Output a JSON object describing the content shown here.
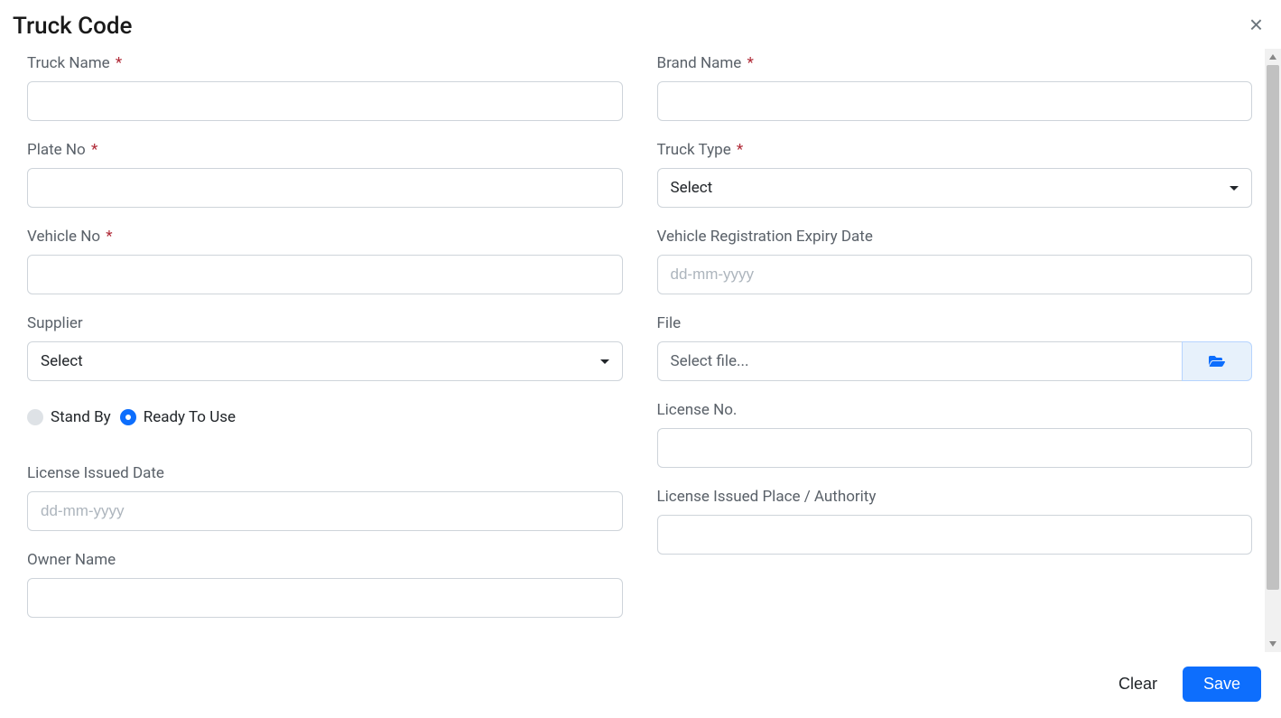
{
  "modal": {
    "title": "Truck Code",
    "close_symbol": "×"
  },
  "form": {
    "left": {
      "truck_name": {
        "label": "Truck Name",
        "required": true,
        "value": ""
      },
      "plate_no": {
        "label": "Plate No",
        "required": true,
        "value": ""
      },
      "vehicle_no": {
        "label": "Vehicle No",
        "required": true,
        "value": ""
      },
      "supplier": {
        "label": "Supplier",
        "selected": "Select"
      },
      "status_radios": {
        "standby": {
          "label": "Stand By",
          "checked": false
        },
        "ready": {
          "label": "Ready To Use",
          "checked": true
        }
      },
      "license_issued_date": {
        "label": "License Issued Date",
        "placeholder": "dd-mm-yyyy",
        "value": ""
      },
      "owner_name": {
        "label": "Owner Name",
        "value": ""
      }
    },
    "right": {
      "brand_name": {
        "label": "Brand Name",
        "required": true,
        "value": ""
      },
      "truck_type": {
        "label": "Truck Type",
        "required": true,
        "selected": "Select"
      },
      "reg_expiry": {
        "label": "Vehicle Registration Expiry Date",
        "placeholder": "dd-mm-yyyy",
        "value": ""
      },
      "file": {
        "label": "File",
        "placeholder": "Select file..."
      },
      "license_no": {
        "label": "License No.",
        "value": ""
      },
      "license_place": {
        "label": "License Issued Place / Authority",
        "value": ""
      }
    }
  },
  "footer": {
    "clear": "Clear",
    "save": "Save"
  },
  "required_marker": "*"
}
